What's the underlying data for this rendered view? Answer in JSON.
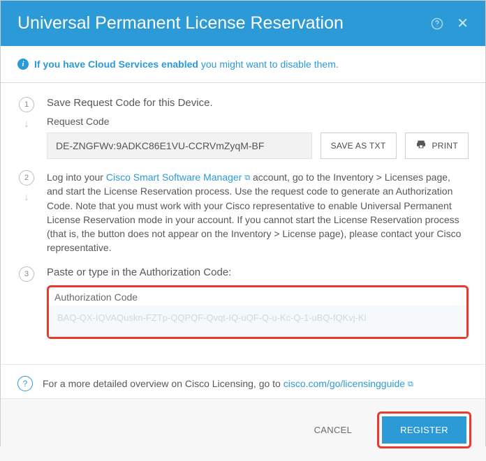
{
  "header": {
    "title": "Universal Permanent License Reservation"
  },
  "info": {
    "bold": "If you have Cloud Services enabled",
    "rest": " you might want to disable them."
  },
  "step1": {
    "num": "1",
    "title": "Save Request Code for this Device.",
    "label": "Request Code",
    "code": "DE-ZNGFWv:9ADKC86E1VU-CCRVmZyqM-BF",
    "save_btn": "SAVE AS TXT",
    "print_btn": "PRINT"
  },
  "step2": {
    "num": "2",
    "pre": "Log into your ",
    "link": "Cisco Smart Software Manager",
    "post": " account, go to the Inventory > Licenses page, and start the License Reservation process. Use the request code to generate an Authorization Code. Note that you must work with your Cisco representative to enable Universal Permanent License Reservation mode in your account. If you cannot start the License Reservation process (that is, the button does not appear on the Inventory > License page), please contact your Cisco representative."
  },
  "step3": {
    "num": "3",
    "title": "Paste or type in the Authorization Code:",
    "auth_label": "Authorization Code",
    "auth_value": "BAQ-QX-IQVAQuskn-FZTp-QQPQF-Qvqt-IQ-uQF-Q-u-Kc-Q-1-uBQ-fQKvj-Kl"
  },
  "help": {
    "pre": "For a more detailed overview on Cisco Licensing, go to ",
    "link": "cisco.com/go/licensingguide"
  },
  "footer": {
    "cancel": "CANCEL",
    "register": "REGISTER"
  }
}
